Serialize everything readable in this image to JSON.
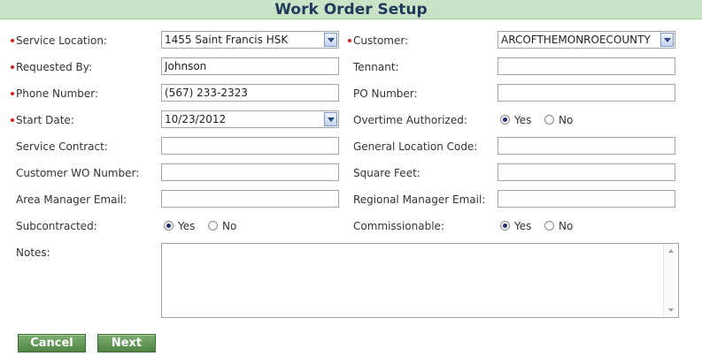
{
  "page": {
    "title": "Work Order Setup"
  },
  "form": {
    "service_location": {
      "label": "Service Location:",
      "value": "1455 Saint Francis HSK",
      "required": true
    },
    "customer": {
      "label": "Customer:",
      "value": "ARCOFTHEMONROECOUNTY",
      "required": true
    },
    "requested_by": {
      "label": "Requested By:",
      "value": "Johnson",
      "required": true
    },
    "tennant": {
      "label": "Tennant:",
      "value": ""
    },
    "phone_number": {
      "label": "Phone Number:",
      "value": "(567) 233-2323",
      "required": true
    },
    "po_number": {
      "label": "PO Number:",
      "value": ""
    },
    "start_date": {
      "label": "Start Date:",
      "value": "10/23/2012",
      "required": true
    },
    "overtime_authorized": {
      "label": "Overtime Authorized:",
      "selected": "Yes",
      "yes": "Yes",
      "no": "No"
    },
    "service_contract": {
      "label": "Service Contract:",
      "value": ""
    },
    "general_location_code": {
      "label": "General Location Code:",
      "value": ""
    },
    "customer_wo_number": {
      "label": "Customer WO Number:",
      "value": ""
    },
    "square_feet": {
      "label": "Square Feet:",
      "value": ""
    },
    "area_manager_email": {
      "label": "Area Manager Email:",
      "value": ""
    },
    "regional_manager_email": {
      "label": "Regional Manager Email:",
      "value": ""
    },
    "subcontracted": {
      "label": "Subcontracted:",
      "selected": "Yes",
      "yes": "Yes",
      "no": "No"
    },
    "commissionable": {
      "label": "Commissionable:",
      "selected": "Yes",
      "yes": "Yes",
      "no": "No"
    },
    "notes": {
      "label": "Notes:",
      "value": ""
    }
  },
  "buttons": {
    "cancel": "Cancel",
    "next": "Next"
  },
  "colors": {
    "header_bg": "#c9e3c6",
    "title_text": "#1f3a5c",
    "required_dot": "#d51f1f",
    "button_green": "#5a8f4e"
  },
  "icons": {
    "dropdown": "chevron-down-icon",
    "scroll_up": "scroll-up-icon",
    "scroll_down": "scroll-down-icon"
  }
}
